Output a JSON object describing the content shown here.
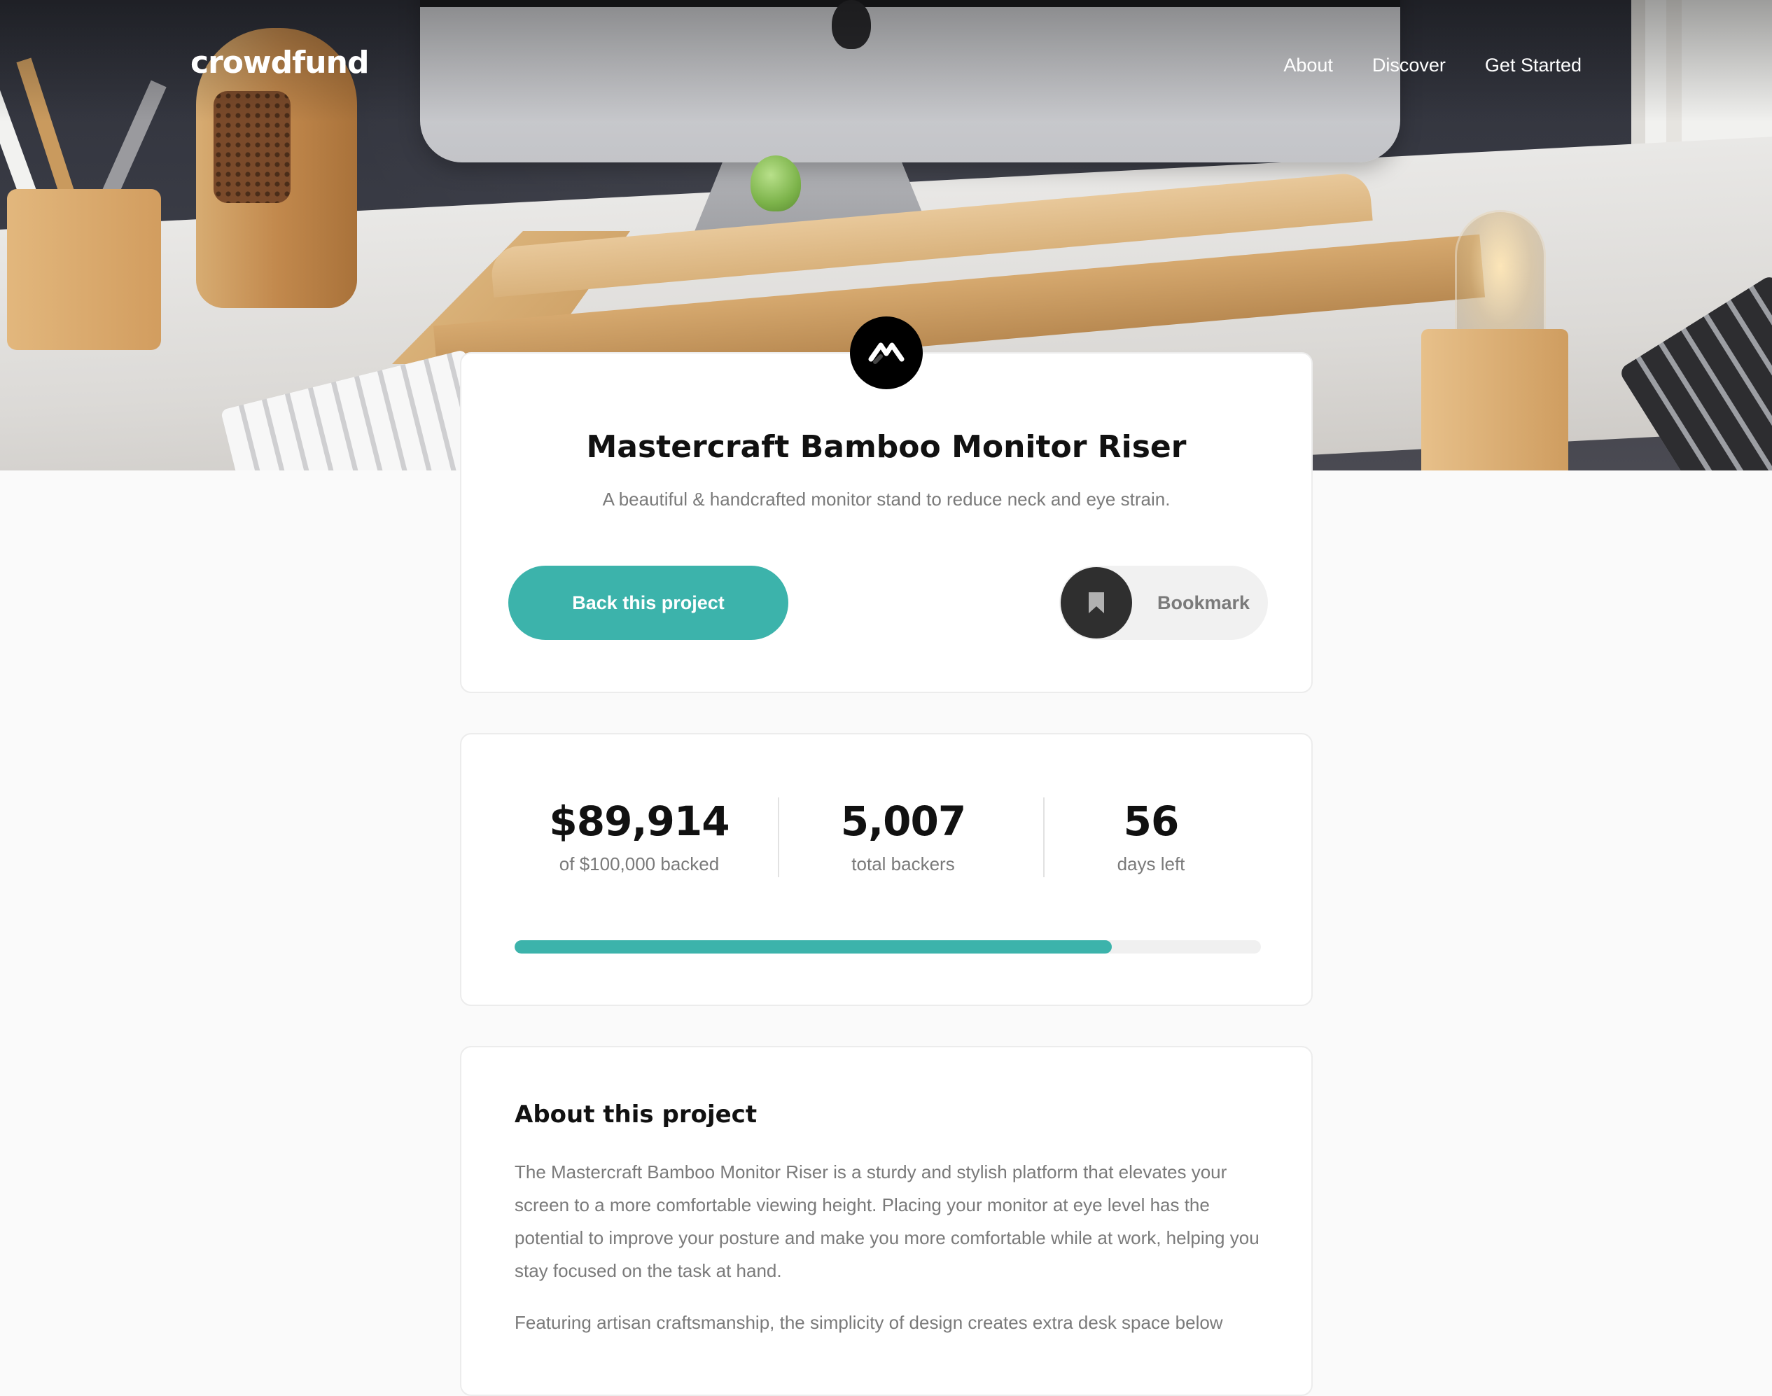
{
  "header": {
    "logo": "crowdfund",
    "nav": [
      "About",
      "Discover",
      "Get Started"
    ]
  },
  "hero": {
    "image": "desk-with-monitor-on-bamboo-riser"
  },
  "project": {
    "logo_icon": "mastercraft-logo-icon",
    "title": "Mastercraft Bamboo Monitor Riser",
    "subtitle": "A beautiful & handcrafted monitor stand to reduce neck and eye strain.",
    "back_button": "Back this project",
    "bookmark_button": "Bookmark"
  },
  "stats": {
    "backed_amount": "$89,914",
    "backed_label": "of $100,000 backed",
    "backers_count": "5,007",
    "backers_label": "total backers",
    "days_left": "56",
    "days_label": "days left",
    "progress_fraction": 0.8
  },
  "about": {
    "title": "About this project",
    "paragraph1": "The Mastercraft Bamboo Monitor Riser is a sturdy and stylish platform that elevates your screen to a more comfortable viewing height. Placing your monitor at eye level has the potential to improve your posture and make you more comfortable while at work, helping you stay focused on the task at hand.",
    "paragraph2": "Featuring artisan craftsmanship, the simplicity of design creates extra desk space below"
  },
  "colors": {
    "accent": "#3cb3ab",
    "dark": "#2f2f2f",
    "muted_text": "#7a7a7a",
    "page_bg": "#fafafa"
  }
}
